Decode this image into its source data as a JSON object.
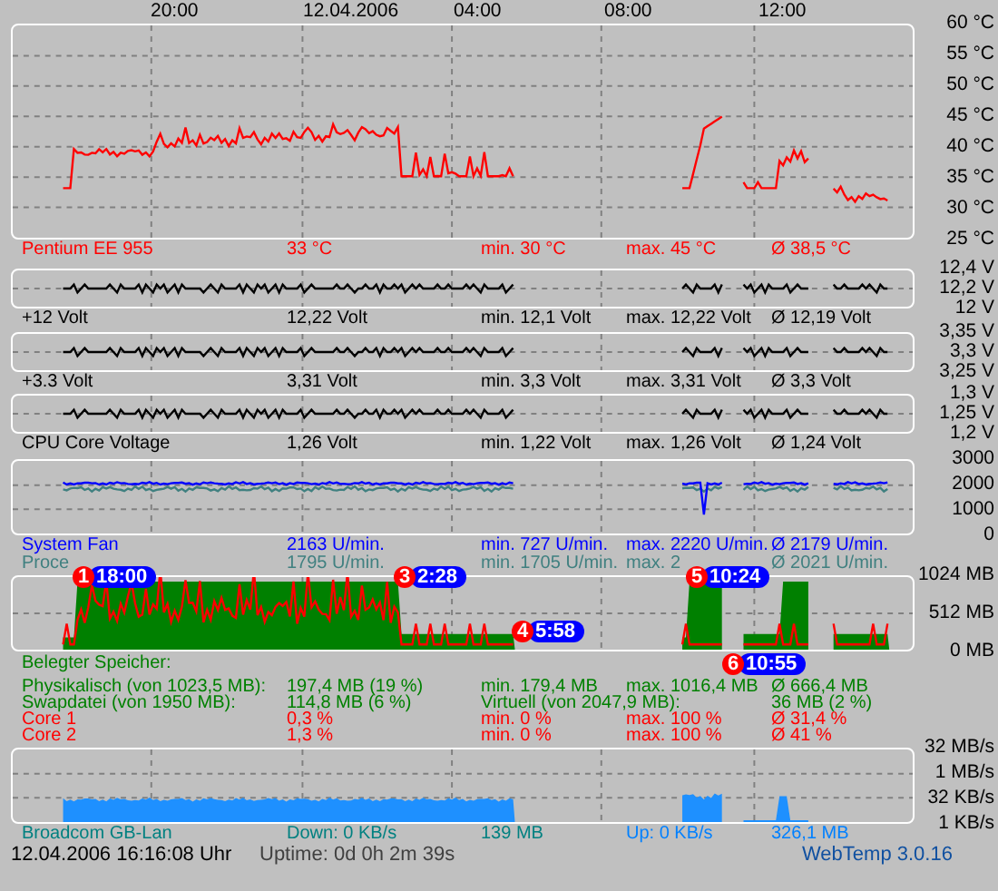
{
  "time_axis": [
    "20:00",
    "12.04.2006",
    "04:00",
    "08:00",
    "12:00"
  ],
  "panels": [
    {
      "kind": "temperature",
      "ticks": [
        "60 °C",
        "55 °C",
        "50 °C",
        "45 °C",
        "40 °C",
        "35 °C",
        "30 °C",
        "25 °C"
      ],
      "traces": [
        {
          "color": "#ff0000"
        }
      ],
      "legend": [
        {
          "color": "#ff0000",
          "cells": [
            "Pentium EE 955",
            "33 °C",
            "min. 30 °C",
            "max. 45 °C",
            "Ø 38,5 °C"
          ]
        }
      ]
    },
    {
      "kind": "voltage",
      "ticks": [
        "12,4 V",
        "12,2 V",
        "12 V"
      ],
      "traces": [
        {
          "color": "#000000"
        }
      ],
      "legend": [
        {
          "color": "#000000",
          "cells": [
            "+12 Volt",
            "12,22 Volt",
            "min. 12,1 Volt",
            "max. 12,22 Volt",
            "Ø 12,19 Volt"
          ]
        }
      ]
    },
    {
      "kind": "voltage",
      "ticks": [
        "3,35 V",
        "3,3 V",
        "3,25 V"
      ],
      "traces": [
        {
          "color": "#000000"
        }
      ],
      "legend": [
        {
          "color": "#000000",
          "cells": [
            "+3.3 Volt",
            "3,31 Volt",
            "min. 3,3 Volt",
            "max. 3,31 Volt",
            "Ø 3,3 Volt"
          ]
        }
      ]
    },
    {
      "kind": "voltage",
      "ticks": [
        "1,3 V",
        "1,25 V",
        "1,2 V"
      ],
      "traces": [
        {
          "color": "#000000"
        }
      ],
      "legend": [
        {
          "color": "#000000",
          "cells": [
            "CPU Core Voltage",
            "1,26 Volt",
            "min. 1,22 Volt",
            "max. 1,26 Volt",
            "Ø 1,24 Volt"
          ]
        }
      ]
    },
    {
      "kind": "fan",
      "ticks": [
        "3000",
        "2000",
        "1000",
        "0"
      ],
      "traces": [
        {
          "color": "#408080"
        },
        {
          "color": "#0000ff"
        }
      ],
      "legend": [
        {
          "color": "#0000ff",
          "cells": [
            "System Fan",
            "2163 U/min.",
            "min. 727 U/min.",
            "max. 2220 U/min.",
            "Ø 2179 U/min."
          ]
        },
        {
          "color": "#408080",
          "cells": [
            "Proce",
            "1795 U/min.",
            "min. 1705 U/min.",
            "max. 2",
            "Ø 2021 U/min."
          ]
        }
      ]
    },
    {
      "kind": "memory",
      "ticks": [
        "1024 MB",
        "512 MB",
        "0 MB"
      ],
      "traces": [
        {
          "color": "#008000"
        },
        {
          "color": "#ff0000"
        }
      ],
      "legend": [
        {
          "kind": "heading",
          "color": "#008000",
          "cells": [
            "Belegter Speicher:"
          ]
        },
        {
          "kind": "normal",
          "color": "#008000",
          "cells": [
            "Physikalisch (von 1023,5 MB):",
            "197,4 MB (19 %)",
            "min. 179,4 MB",
            "max. 1016,4 MB",
            "Ø 666,4 MB"
          ]
        },
        {
          "kind": "wide",
          "color": "#008000",
          "cells": [
            "Swapdatei (von 1950 MB):",
            "114,8 MB (6 %)",
            "Virtuell (von 2047,9 MB):",
            "36 MB (2 %)"
          ]
        },
        {
          "kind": "normal",
          "color": "#ff0000",
          "cells": [
            "Core 1",
            "0,3 %",
            "min. 0 %",
            "max. 100 %",
            "Ø 31,4 %"
          ]
        },
        {
          "kind": "normal",
          "color": "#ff0000",
          "cells": [
            "Core 2",
            "1,3 %",
            "min. 0 %",
            "max. 100 %",
            "Ø 41 %"
          ]
        }
      ]
    },
    {
      "kind": "network",
      "ticks": [
        "32 MB/s",
        "1 MB/s",
        "32 KB/s",
        "1 KB/s"
      ],
      "traces": [
        {
          "color": "#1e90ff"
        }
      ],
      "legend": [
        {
          "color": "#008080",
          "cells": [
            "Broadcom GB-Lan",
            {
              "text": "Down: 0 KB/s",
              "color": "#008080"
            },
            {
              "text": "139 MB",
              "color": "#008080"
            },
            {
              "text": "Up: 0 KB/s",
              "color": "#0080ff"
            },
            {
              "text": "326,1 MB",
              "color": "#0080ff"
            }
          ]
        }
      ]
    }
  ],
  "markers": [
    {
      "number": "1",
      "time": "18:00"
    },
    {
      "number": "3",
      "time": "2:28"
    },
    {
      "number": "5",
      "time": "10:24"
    },
    {
      "number": "4",
      "time": "5:58"
    },
    {
      "number": "6",
      "time": "10:55"
    }
  ],
  "status": {
    "datetime": "12.04.2006 16:16:08 Uhr",
    "uptime": "Uptime: 0d 0h 2m 39s",
    "version": "WebTemp 3.0.16"
  }
}
